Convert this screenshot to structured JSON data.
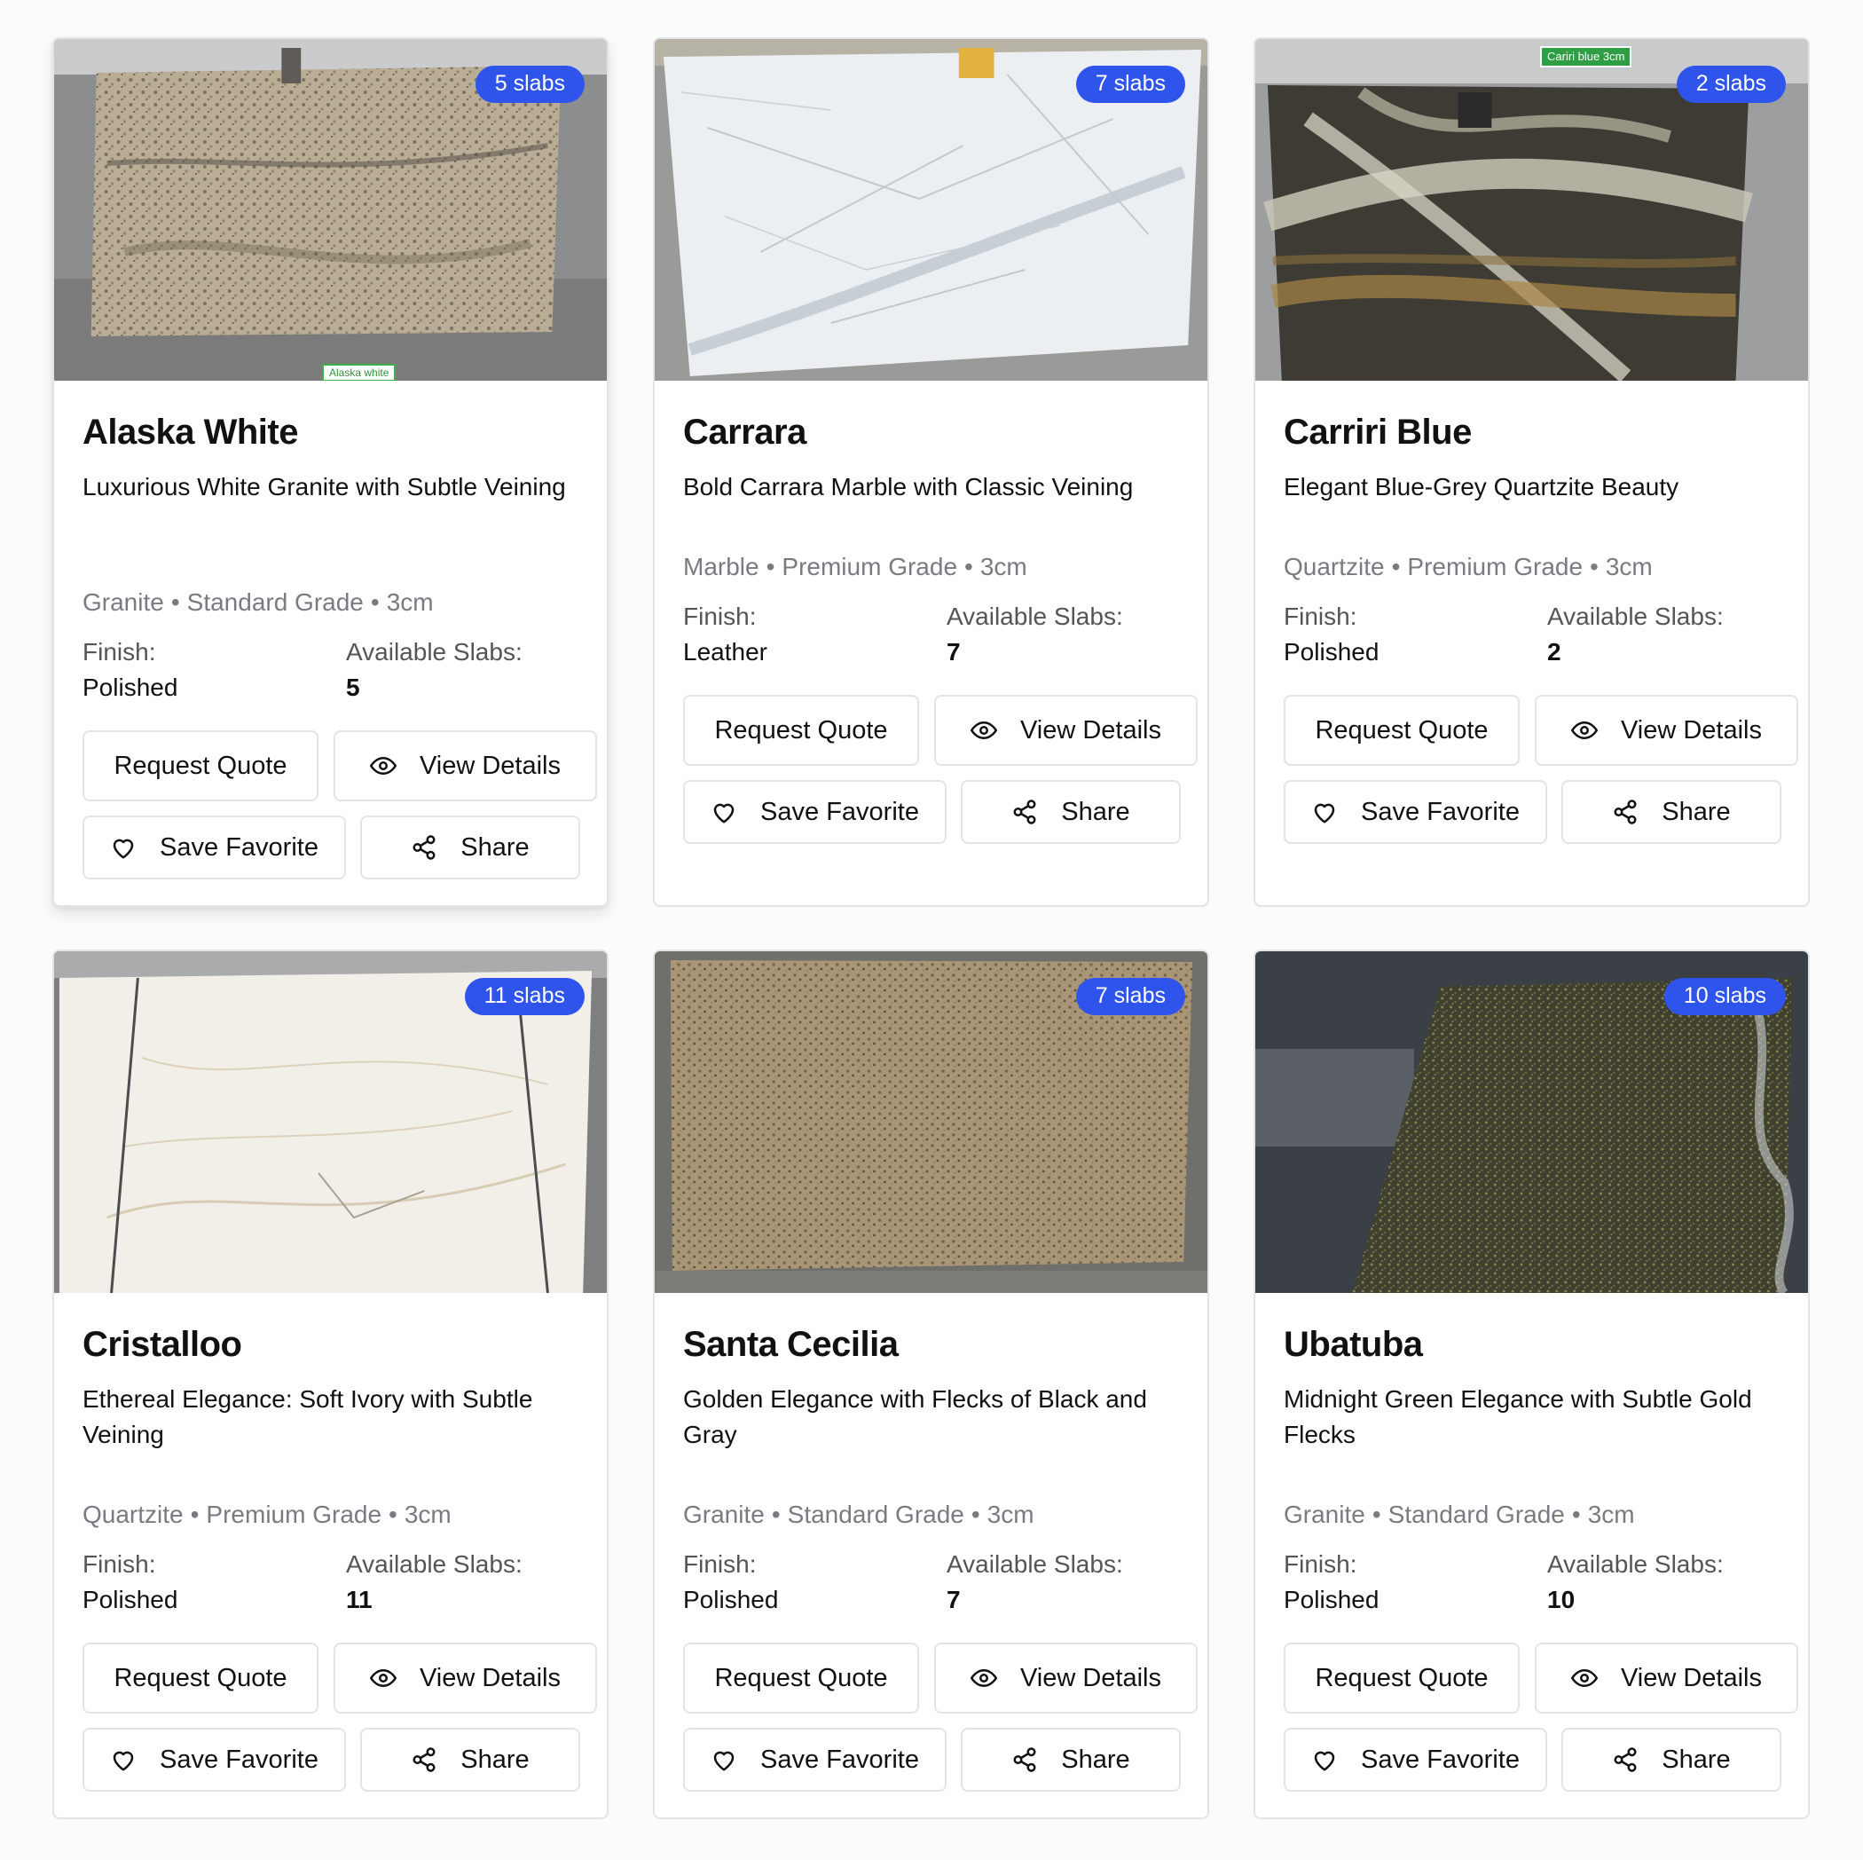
{
  "cards": [
    {
      "name": "Alaska White",
      "description": "Luxurious White Granite with Subtle Veining",
      "type": "Granite",
      "grade": "Standard Grade",
      "thickness": "3cm",
      "finish_label": "Finish:",
      "finish": "Polished",
      "slabs_label": "Available Slabs:",
      "slabs": "5",
      "badge": "5 slabs",
      "image_tag": "Alaska white"
    },
    {
      "name": "Carrara",
      "description": "Bold Carrara Marble with Classic Veining",
      "type": "Marble",
      "grade": "Premium Grade",
      "thickness": "3cm",
      "finish_label": "Finish:",
      "finish": "Leather",
      "slabs_label": "Available Slabs:",
      "slabs": "7",
      "badge": "7 slabs"
    },
    {
      "name": "Carriri Blue",
      "description": "Elegant Blue-Grey Quartzite Beauty",
      "type": "Quartzite",
      "grade": "Premium Grade",
      "thickness": "3cm",
      "finish_label": "Finish:",
      "finish": "Polished",
      "slabs_label": "Available Slabs:",
      "slabs": "2",
      "badge": "2 slabs",
      "image_tag": "Cariri blue 3cm"
    },
    {
      "name": "Cristalloo",
      "description": "Ethereal Elegance: Soft Ivory with Subtle Veining",
      "type": "Quartzite",
      "grade": "Premium Grade",
      "thickness": "3cm",
      "finish_label": "Finish:",
      "finish": "Polished",
      "slabs_label": "Available Slabs:",
      "slabs": "11",
      "badge": "11 slabs"
    },
    {
      "name": "Santa Cecilia",
      "description": "Golden Elegance with Flecks of Black and Gray",
      "type": "Granite",
      "grade": "Standard Grade",
      "thickness": "3cm",
      "finish_label": "Finish:",
      "finish": "Polished",
      "slabs_label": "Available Slabs:",
      "slabs": "7",
      "badge": "7 slabs"
    },
    {
      "name": "Ubatuba",
      "description": "Midnight Green Elegance with Subtle Gold Flecks",
      "type": "Granite",
      "grade": "Standard Grade",
      "thickness": "3cm",
      "finish_label": "Finish:",
      "finish": "Polished",
      "slabs_label": "Available Slabs:",
      "slabs": "10",
      "badge": "10 slabs"
    }
  ],
  "buttons": {
    "request_quote": "Request Quote",
    "view_details": "View Details",
    "save_favorite": "Save Favorite",
    "share": "Share"
  },
  "separator": "•",
  "icons": {
    "view_details": "eye-icon",
    "save_favorite": "heart-icon",
    "share": "share-icon"
  },
  "colors": {
    "badge": "#2f54eb",
    "border": "#e4e4e7",
    "muted_text": "#7a7a82"
  }
}
